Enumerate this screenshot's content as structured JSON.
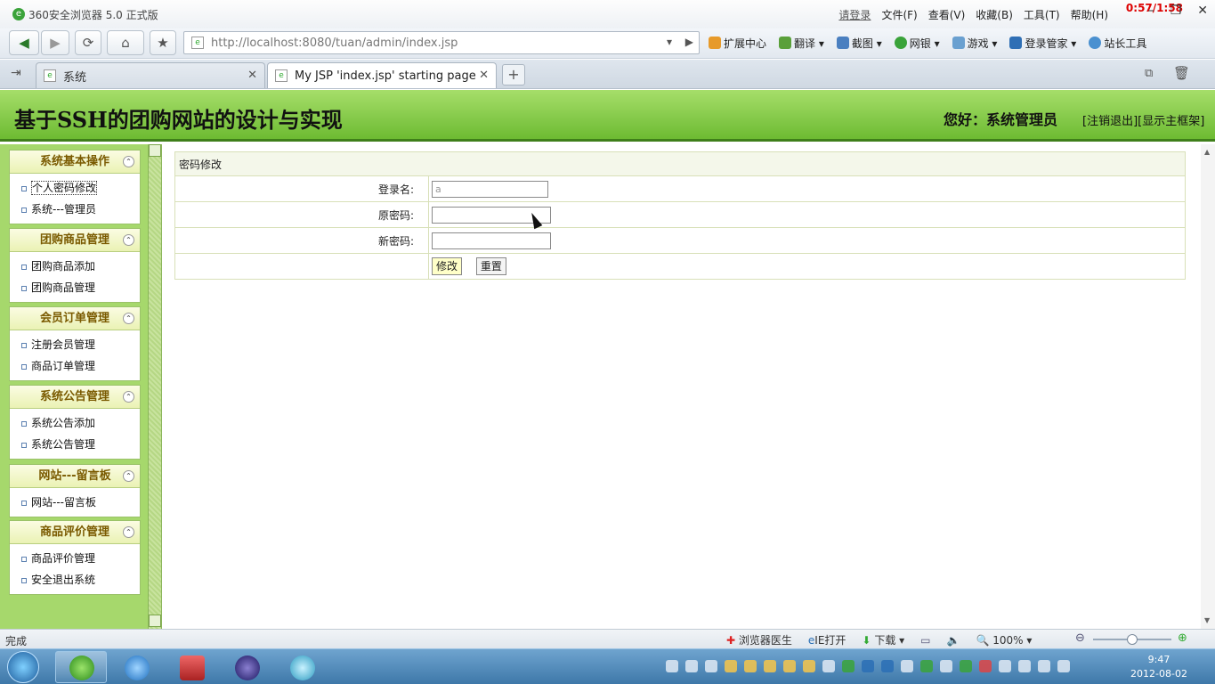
{
  "browser": {
    "title": "360安全浏览器 5.0 正式版",
    "menus": [
      "请登录",
      "文件(F)",
      "查看(V)",
      "收藏(B)",
      "工具(T)",
      "帮助(H)"
    ],
    "clock_overlay": "0:57/1:58",
    "url": "http://localhost:8080/tuan/admin/index.jsp",
    "toolbar": [
      "扩展中心",
      "翻译",
      "截图",
      "网银",
      "游戏",
      "登录管家",
      "站长工具"
    ],
    "tabs": [
      {
        "label": "系统"
      },
      {
        "label": "My JSP 'index.jsp' starting page"
      }
    ]
  },
  "page": {
    "site_title": "基于SSH的团购网站的设计与实现",
    "greeting": "您好：系统管理员",
    "logout_link": "[注销退出]",
    "frame_link": "[显示主框架]"
  },
  "sidebar": {
    "groups": [
      {
        "title": "系统基本操作",
        "items": [
          "个人密码修改",
          "系统---管理员"
        ]
      },
      {
        "title": "团购商品管理",
        "items": [
          "团购商品添加",
          "团购商品管理"
        ]
      },
      {
        "title": "会员订单管理",
        "items": [
          "注册会员管理",
          "商品订单管理"
        ]
      },
      {
        "title": "系统公告管理",
        "items": [
          "系统公告添加",
          "系统公告管理"
        ]
      },
      {
        "title": "网站---留言板",
        "items": [
          "网站---留言板"
        ]
      },
      {
        "title": "商品评价管理",
        "items": [
          "商品评价管理",
          "安全退出系统"
        ]
      }
    ]
  },
  "form": {
    "heading": "密码修改",
    "login_label": "登录名:",
    "login_value": "a",
    "old_password_label": "原密码:",
    "new_password_label": "新密码:",
    "submit_label": "修改",
    "reset_label": "重置"
  },
  "statusbar": {
    "status": "完成",
    "items": [
      "浏览器医生",
      "IE打开",
      "下载"
    ],
    "zoom": "100%"
  },
  "taskbar": {
    "time": "9:47",
    "date": "2012-08-02"
  },
  "colors": {
    "header_green": "#6dbb32",
    "sidebar_green": "#a6d86c",
    "group_title": "#7a5a00"
  }
}
